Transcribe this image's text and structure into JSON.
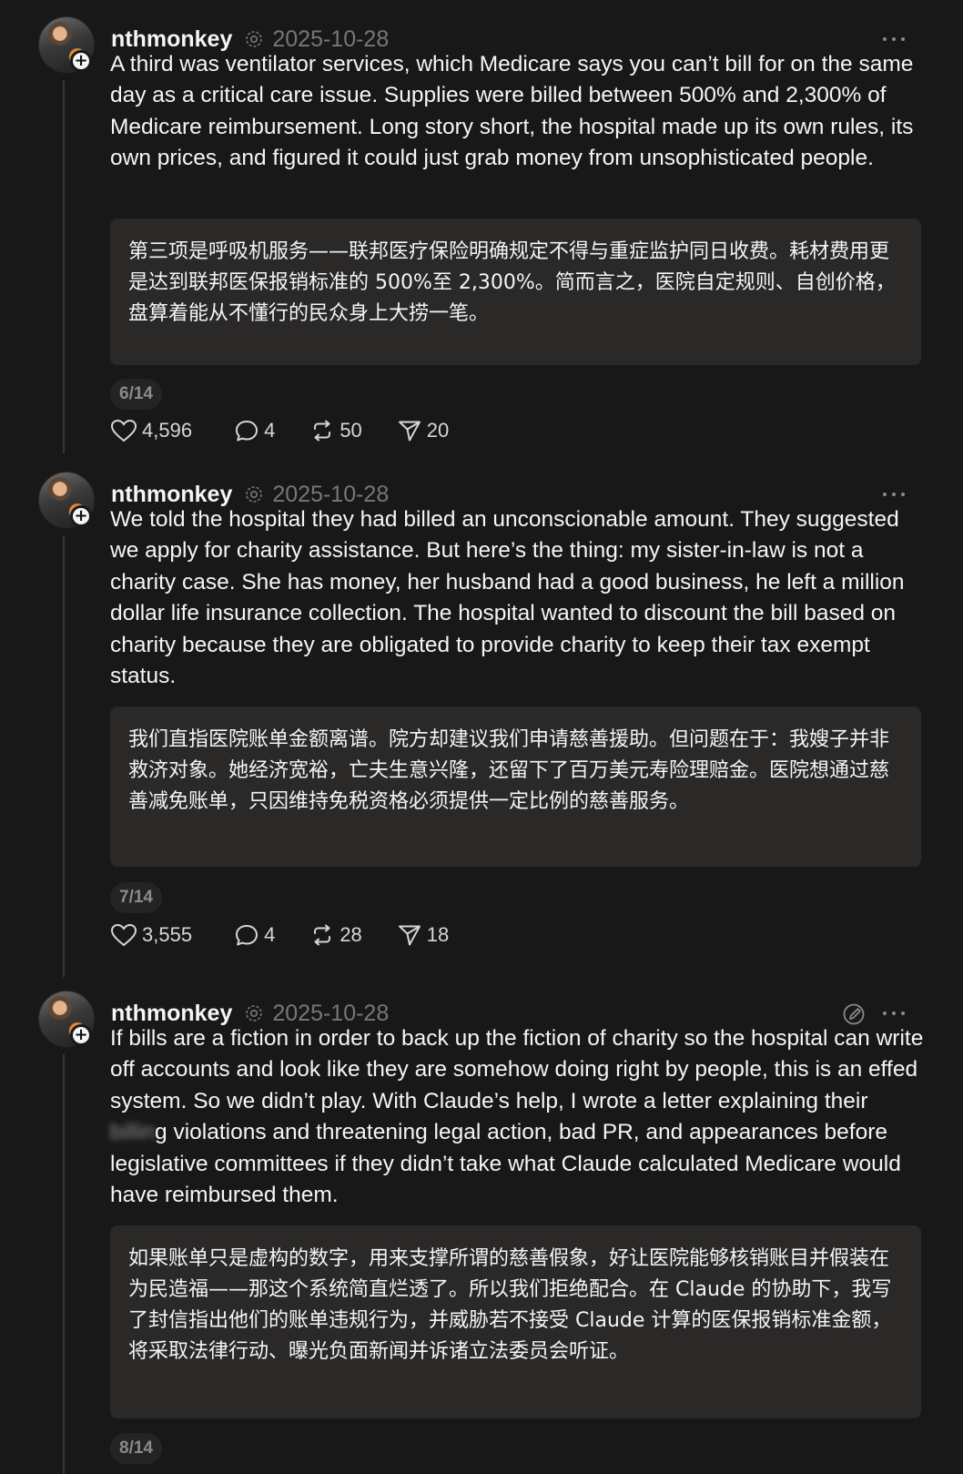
{
  "posts": [
    {
      "username": "nthmonkey",
      "date": "2025-10-28",
      "text": "A third was ventilator services, which Medicare says you can’t bill for on the same day as a critical care issue. Supplies were billed between 500% and 2,300% of Medicare reimbursement. Long story short, the hospital made up its own rules, its own prices, and figured it could just grab money from unsophisticated people.",
      "translation": "第三项是呼吸机服务——联邦医疗保险明确规定不得与重症监护同日收费。耗材费用更是达到联邦医保报销标准的 500%至 2,300%。简而言之，医院自定规则、自创价格，盘算着能从不懂行的民众身上大捞一笔。",
      "page": "6/14",
      "likes": "4,596",
      "replies": "4",
      "reposts": "50",
      "shares": "20"
    },
    {
      "username": "nthmonkey",
      "date": "2025-10-28",
      "text": "We told the hospital they had billed an unconscionable amount. They suggested we apply for charity assistance. But here’s the thing: my sister-in-law is not a charity case. She has money, her husband had a good business, he left a million dollar life insurance collection. The hospital wanted to discount the bill based on charity because they are obligated to provide charity to keep their tax exempt status.",
      "translation": "我们直指医院账单金额离谱。院方却建议我们申请慈善援助。但问题在于：我嫂子并非救济对象。她经济宽裕，亡夫生意兴隆，还留下了百万美元寿险理赔金。医院想通过慈善减免账单，只因维持免税资格必须提供一定比例的慈善服务。",
      "page": "7/14",
      "likes": "3,555",
      "replies": "4",
      "reposts": "28",
      "shares": "18"
    },
    {
      "username": "nthmonkey",
      "date": "2025-10-28",
      "text_before_blur": "If bills are a fiction in order to back up the fiction of charity so the hospital can write off accounts and look like they are somehow doing right by people, this is an effed system. So we didn’t play. With Claude’s help, I wrote a letter explaining their ",
      "text_blurred": "billin",
      "text_after_blur": "g violations and threatening legal action, bad PR, and appearances before legislative committees if they didn’t take what Claude calculated Medicare would have reimbursed them.",
      "translation": "如果账单只是虚构的数字，用来支撑所谓的慈善假象，好让医院能够核销账目并假装在为民造福——那这个系统简直烂透了。所以我们拒绝配合。在 Claude 的协助下，我写了封信指出他们的账单违规行为，并威胁若不接受 Claude 计算的医保报销标准金额，将采取法律行动、曝光负面新闻并诉诸立法委员会听证。",
      "page": "8/14"
    }
  ],
  "colors": {
    "background": "#181818",
    "text": "#f3f5f7",
    "muted": "#777777",
    "translation_bg": "#2b2828",
    "thread_line": "#333638"
  },
  "icons": [
    "ai-label-icon",
    "more-icon",
    "heart-icon",
    "reply-icon",
    "repost-icon",
    "share-icon",
    "edit-icon",
    "plus-icon"
  ]
}
